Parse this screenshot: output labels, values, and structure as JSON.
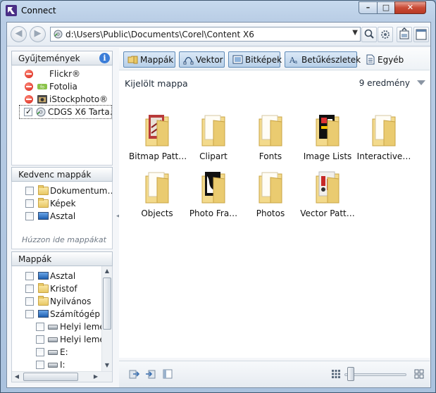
{
  "window": {
    "title": "Connect",
    "controls": {
      "minimize": "–",
      "maximize": "□",
      "close": "✕"
    }
  },
  "address": {
    "path": "d:\\Users\\Public\\Documents\\Corel\\Content X6"
  },
  "panes": {
    "collections": {
      "title": "Gyűjtemények",
      "items": [
        {
          "label": "Flickr®",
          "state": "disabled"
        },
        {
          "label": "Fotolia",
          "state": "disabled"
        },
        {
          "label": "iStockphoto®",
          "state": "disabled"
        },
        {
          "label": "CDGS X6 Tarta…",
          "state": "checked"
        }
      ]
    },
    "favorites": {
      "title": "Kedvenc mappák",
      "items": [
        {
          "label": "Dokumentum…"
        },
        {
          "label": "Képek"
        },
        {
          "label": "Asztal"
        }
      ],
      "drop_hint": "Húzzon ide mappákat"
    },
    "folders": {
      "title": "Mappák",
      "items": [
        {
          "label": "Asztal"
        },
        {
          "label": "Kristof"
        },
        {
          "label": "Nyilvános"
        },
        {
          "label": "Számítógép"
        },
        {
          "label": "Helyi lemez"
        },
        {
          "label": "Helyi lemez"
        },
        {
          "label": "E:"
        },
        {
          "label": "I:"
        }
      ]
    }
  },
  "filters": [
    {
      "label": "Mappák",
      "active": true
    },
    {
      "label": "Vektor",
      "active": true
    },
    {
      "label": "Bitképek",
      "active": true
    },
    {
      "label": "Betűkészletek",
      "active": true
    },
    {
      "label": "Egyéb",
      "active": false
    }
  ],
  "content": {
    "section_title": "Kijelölt mappa",
    "count": "9 eredmény",
    "items": [
      {
        "label": "Bitmap Patt…"
      },
      {
        "label": "Clipart"
      },
      {
        "label": "Fonts"
      },
      {
        "label": "Image Lists"
      },
      {
        "label": "Interactive…"
      },
      {
        "label": "Objects"
      },
      {
        "label": "Photo Fra…"
      },
      {
        "label": "Photos"
      },
      {
        "label": "Vector Patt…"
      }
    ]
  },
  "colors": {
    "accent": "#5f8bb8",
    "folder": "#e8c865",
    "titlebar": "#b9cde5",
    "close": "#c94a35"
  }
}
